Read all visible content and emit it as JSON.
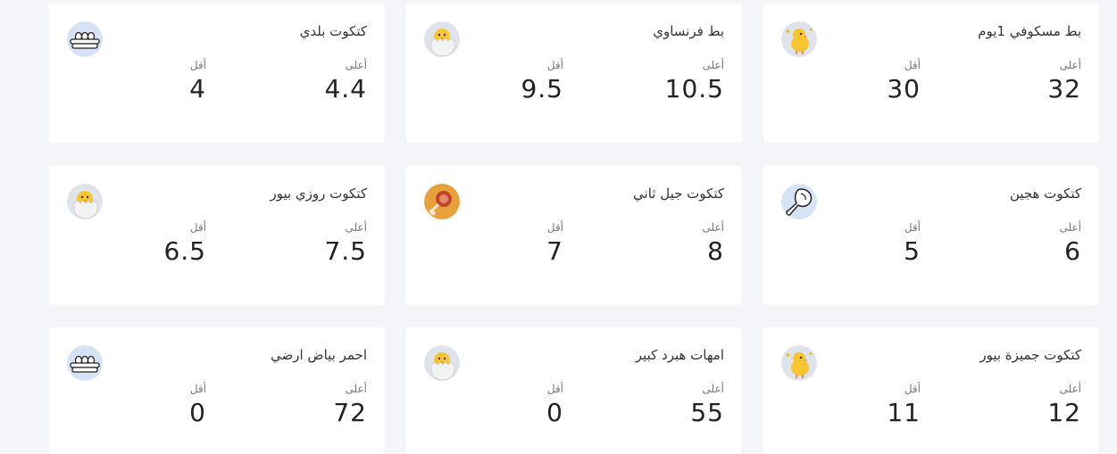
{
  "labels": {
    "high": "أعلى",
    "low": "أقل"
  },
  "cards": [
    {
      "title": "بط مسكوفي 1يوم",
      "high": "32",
      "low": "30",
      "icon": "chick-sparkle-icon"
    },
    {
      "title": "بط فرنساوي",
      "high": "10.5",
      "low": "9.5",
      "icon": "chick-egg-icon"
    },
    {
      "title": "كتكوت بلدي",
      "high": "4.4",
      "low": "4",
      "icon": "egg-tray-icon"
    },
    {
      "title": "كتكوت هجين",
      "high": "6",
      "low": "5",
      "icon": "chicken-leg-icon"
    },
    {
      "title": "كتكوت جيل ثاني",
      "high": "8",
      "low": "7",
      "icon": "meat-drumstick-icon"
    },
    {
      "title": "كتكوت روزي بيور",
      "high": "7.5",
      "low": "6.5",
      "icon": "chick-egg-icon"
    },
    {
      "title": "كتكوت جميزة بيور",
      "high": "12",
      "low": "11",
      "icon": "chick-sparkle-icon"
    },
    {
      "title": "امهات هبرد كبير",
      "high": "55",
      "low": "0",
      "icon": "chick-egg-icon"
    },
    {
      "title": "احمر بياض ارضي",
      "high": "72",
      "low": "0",
      "icon": "egg-tray-icon"
    }
  ]
}
